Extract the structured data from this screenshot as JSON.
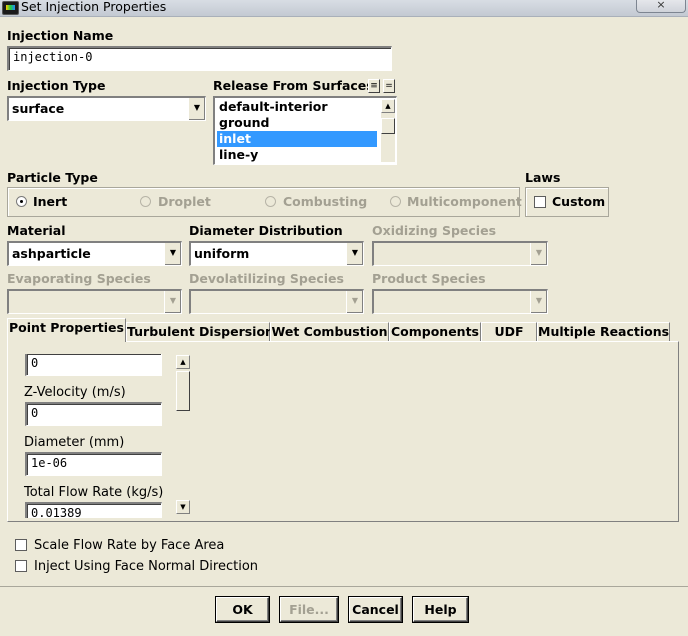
{
  "window": {
    "title": "Set Injection Properties",
    "close_label": "×"
  },
  "injection_name": {
    "label": "Injection Name",
    "value": "injection-0"
  },
  "injection_type": {
    "label": "Injection Type",
    "value": "surface"
  },
  "release_from_surfaces": {
    "label": "Release From Surfaces",
    "items": [
      "default-interior",
      "ground",
      "inlet",
      "line-y"
    ],
    "selected": "inlet"
  },
  "particle_type": {
    "label": "Particle Type",
    "options": [
      "Inert",
      "Droplet",
      "Combusting",
      "Multicomponent"
    ],
    "selected": "Inert"
  },
  "laws": {
    "label": "Laws",
    "custom_label": "Custom"
  },
  "material": {
    "label": "Material",
    "value": "ashparticle"
  },
  "diameter_distribution": {
    "label": "Diameter Distribution",
    "value": "uniform"
  },
  "oxidizing_species": {
    "label": "Oxidizing Species",
    "value": ""
  },
  "evaporating_species": {
    "label": "Evaporating Species",
    "value": ""
  },
  "devolatilizing_species": {
    "label": "Devolatilizing Species",
    "value": ""
  },
  "product_species": {
    "label": "Product Species",
    "value": ""
  },
  "tabs": [
    {
      "label": "Point Properties",
      "active": true
    },
    {
      "label": "Turbulent Dispersion"
    },
    {
      "label": "Wet Combustion"
    },
    {
      "label": "Components"
    },
    {
      "label": "UDF"
    },
    {
      "label": "Multiple Reactions"
    }
  ],
  "point_properties": {
    "top_value": "0",
    "z_velocity": {
      "label": "Z-Velocity (m/s)",
      "value": "0"
    },
    "diameter": {
      "label": "Diameter (mm)",
      "value": "1e-06"
    },
    "total_flow_rate": {
      "label": "Total Flow Rate (kg/s)",
      "value": "0.01389"
    }
  },
  "options": {
    "scale_flow_rate": "Scale Flow Rate by Face Area",
    "inject_face_normal": "Inject Using Face Normal Direction"
  },
  "buttons": {
    "ok": "OK",
    "file": "File...",
    "cancel": "Cancel",
    "help": "Help"
  }
}
